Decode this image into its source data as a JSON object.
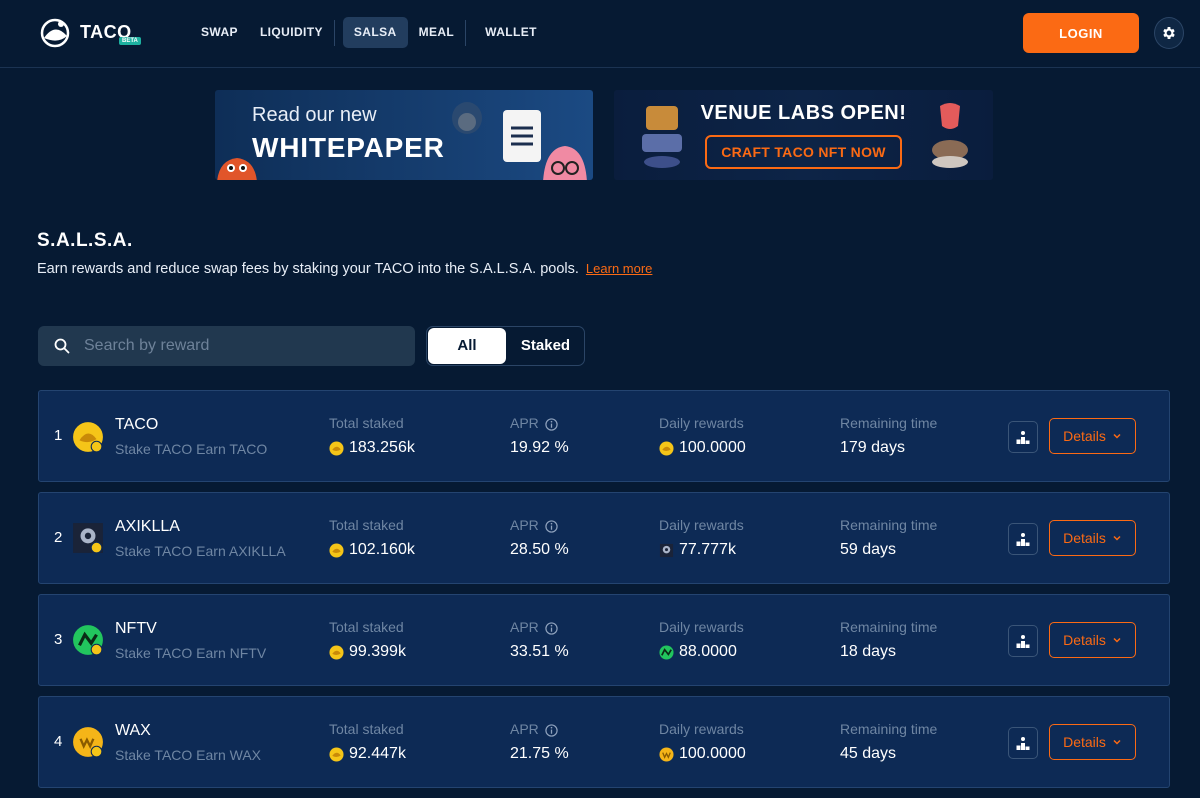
{
  "header": {
    "logo_text": "TACO",
    "logo_badge": "BETA",
    "nav": [
      "SWAP",
      "LIQUIDITY",
      "SALSA",
      "MEAL",
      "WALLET"
    ],
    "active_nav": "SALSA",
    "login_label": "LOGIN"
  },
  "banners": {
    "whitepaper_small": "Read our new",
    "whitepaper_big": "WHITEPAPER",
    "venue_title": "VENUE LABS OPEN!",
    "venue_button": "CRAFT TACO NFT NOW"
  },
  "page": {
    "title": "S.A.L.S.A.",
    "description": "Earn rewards and reduce swap fees by staking your TACO into the S.A.L.S.A. pools.",
    "learn_more": "Learn more"
  },
  "search": {
    "placeholder": "Search by reward"
  },
  "filters": {
    "all": "All",
    "staked": "Staked",
    "active": "All"
  },
  "columns": {
    "total_staked": "Total staked",
    "apr": "APR",
    "daily_rewards": "Daily rewards",
    "remaining_time": "Remaining time"
  },
  "details_label": "Details",
  "pools": [
    {
      "rank": "1",
      "name": "TACO",
      "subtitle": "Stake TACO Earn TACO",
      "total_staked": "183.256k",
      "apr": "19.92 %",
      "daily_rewards": "100.0000",
      "remaining": "179 days",
      "icon": "taco-token-icon",
      "reward_icon": "taco-token-icon",
      "color": "#f5c518"
    },
    {
      "rank": "2",
      "name": "AXIKLLA",
      "subtitle": "Stake TACO Earn AXIKLLA",
      "total_staked": "102.160k",
      "apr": "28.50 %",
      "daily_rewards": "77.777k",
      "remaining": "59 days",
      "icon": "axiklla-token-icon",
      "reward_icon": "axiklla-token-icon",
      "color": "#3b4a6b"
    },
    {
      "rank": "3",
      "name": "NFTV",
      "subtitle": "Stake TACO Earn NFTV",
      "total_staked": "99.399k",
      "apr": "33.51 %",
      "daily_rewards": "88.0000",
      "remaining": "18 days",
      "icon": "nftv-token-icon",
      "reward_icon": "nftv-token-icon",
      "color": "#22c55e"
    },
    {
      "rank": "4",
      "name": "WAX",
      "subtitle": "Stake TACO Earn WAX",
      "total_staked": "92.447k",
      "apr": "21.75 %",
      "daily_rewards": "100.0000",
      "remaining": "45 days",
      "icon": "wax-token-icon",
      "reward_icon": "wax-token-icon",
      "color": "#f5b518"
    }
  ]
}
